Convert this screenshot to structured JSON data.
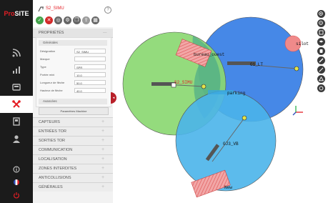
{
  "app": {
    "brand_pro": "Pro",
    "brand_site": "SITE"
  },
  "header": {
    "device_name": "S2_SIMU",
    "help": "?"
  },
  "properties": {
    "title": "PROPRIÉTÉS",
    "collapse_symbol": "—",
    "general_title": "Générales",
    "fields": [
      {
        "label": "Désignation",
        "value": "S2_SIMU"
      },
      {
        "label": "Marque",
        "value": ""
      },
      {
        "label": "Type",
        "value": "SPR"
      },
      {
        "label": "Portée mini",
        "value": "10.0"
      },
      {
        "label": "Longueur de flèche",
        "value": "50.0"
      },
      {
        "label": "Hauteur de flèche",
        "value": "40.0"
      }
    ],
    "advanced_title": "Avancées",
    "advanced_button": "Paramètres Machine"
  },
  "sections": [
    {
      "label": "CAPTEURS"
    },
    {
      "label": "ENTRÉES TOR"
    },
    {
      "label": "SORTIES TOR"
    },
    {
      "label": "COMMUNICATION"
    },
    {
      "label": "LOCALISATION"
    },
    {
      "label": "ZONES INTERDITES"
    },
    {
      "label": "ANTICOLLISIONS"
    },
    {
      "label": "GÉNÉRALES"
    }
  ],
  "section_symbol": "+",
  "map": {
    "labels": {
      "bureau": "bureau_ouest",
      "silot": "silot",
      "gl": "G1_LT",
      "s2": "S2_SIMU",
      "parking": "parking",
      "gj3": "GJ3_VB",
      "new": "New"
    },
    "colors": {
      "green_zone": "#8bd872",
      "blue_zone": "#3c82e6",
      "cyan_zone": "#4ab4ea",
      "pink_zone": "#f08a8a",
      "accent_red": "#e41e25"
    }
  }
}
